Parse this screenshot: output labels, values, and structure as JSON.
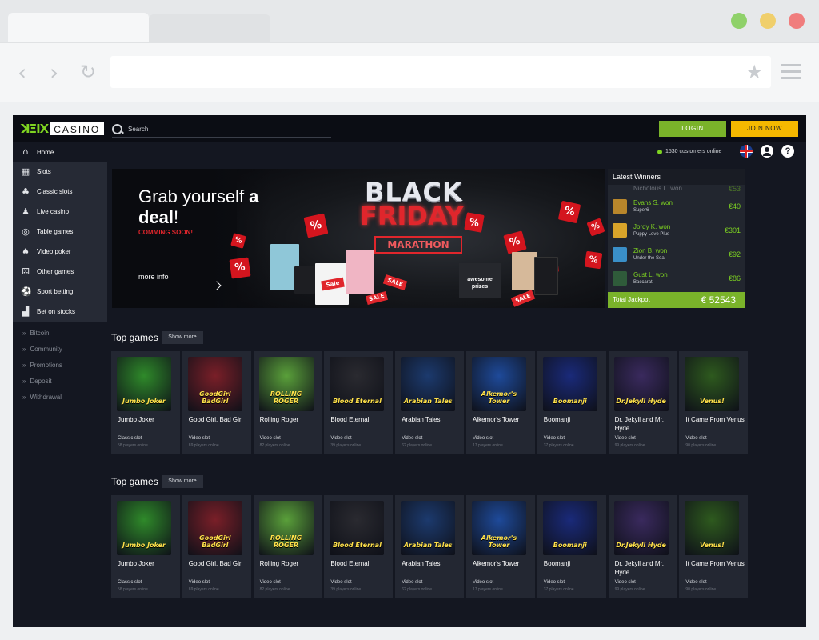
{
  "browser": {
    "url": ""
  },
  "header": {
    "logo_mark": "ꓘΞIX",
    "logo_text": "CASINO",
    "search_placeholder": "Search",
    "login_label": "LOGIN",
    "join_label": "JOIN NOW",
    "online_text": "1530 customers online",
    "help_glyph": "?"
  },
  "sidebar": {
    "home": "Home",
    "items": [
      {
        "label": "Slots",
        "icon": "slots-icon",
        "glyph": "▦"
      },
      {
        "label": "Classic slots",
        "icon": "cherries-icon",
        "glyph": "♣"
      },
      {
        "label": "Live casino",
        "icon": "dealer-icon",
        "glyph": "♟"
      },
      {
        "label": "Table games",
        "icon": "chips-icon",
        "glyph": "◎"
      },
      {
        "label": "Video poker",
        "icon": "cards-icon",
        "glyph": "♠"
      },
      {
        "label": "Other games",
        "icon": "dice-icon",
        "glyph": "⚄"
      },
      {
        "label": "Sport betting",
        "icon": "soccer-ball-icon",
        "glyph": "⚽"
      },
      {
        "label": "Bet on stocks",
        "icon": "chart-icon",
        "glyph": "▟"
      }
    ],
    "subnav": [
      "Bitcoin",
      "Community",
      "Promotions",
      "Deposit",
      "Withdrawal"
    ]
  },
  "banner": {
    "title_1": "Grab yourself ",
    "title_bold_1": "a",
    "title_bold_2": "deal",
    "title_end": "!",
    "subtitle": "COMMING SOON!",
    "more_info": "more info",
    "bf_black": "BLACK",
    "bf_friday": "FRIDAY",
    "bf_marathon": "MARATHON",
    "sale": "Sale",
    "box_label": "awesome prizes"
  },
  "winners": {
    "title": "Latest Winners",
    "rows": [
      {
        "name": "Evans S. won",
        "game": "Super6",
        "amount": "€40",
        "color": "#b8862b"
      },
      {
        "name": "Jordy K. won",
        "game": "Puppy Love Plus",
        "amount": "€301",
        "color": "#d9a42a"
      },
      {
        "name": "Zion B. won",
        "game": "Under the Sea",
        "amount": "€92",
        "color": "#3a8fc8"
      },
      {
        "name": "Gust L. won",
        "game": "Baccarat",
        "amount": "€86",
        "color": "#2f5b3a"
      }
    ],
    "partial": {
      "name": "Nicholous L. won",
      "amount": "€53"
    },
    "total_label": "Total Jackpot",
    "total_value": "€ 52543"
  },
  "sections": [
    {
      "title": "Top games",
      "show_more": "Show more"
    },
    {
      "title": "Top games",
      "show_more": "Show more"
    }
  ],
  "games": [
    {
      "name": "Jumbo Joker",
      "category": "Classic slot",
      "players": "58 players online",
      "art": "Jumbo Joker",
      "bg": "#2f8a2a"
    },
    {
      "name": "Good Girl, Bad Girl",
      "category": "Video slot",
      "players": "89 players online",
      "art": "GoodGirl BadGirl",
      "bg": "#7a1f28"
    },
    {
      "name": "Rolling Roger",
      "category": "Video slot",
      "players": "82 players online",
      "art": "ROLLING ROGER",
      "bg": "#5aa03a"
    },
    {
      "name": "Blood Eternal",
      "category": "Video slot",
      "players": "39 players online",
      "art": "Blood Eternal",
      "bg": "#2a2a30"
    },
    {
      "name": "Arabian Tales",
      "category": "Video slot",
      "players": "62 players online",
      "art": "Arabian Tales",
      "bg": "#1c3a6e"
    },
    {
      "name": "Alkemor's Tower",
      "category": "Video slot",
      "players": "17 players online",
      "art": "Alkemor's Tower",
      "bg": "#1e4a9a"
    },
    {
      "name": "Boomanji",
      "category": "Video slot",
      "players": "37 players online",
      "art": "Boomanji",
      "bg": "#1a2a7a"
    },
    {
      "name": "Dr. Jekyll and Mr. Hyde",
      "category": "Video slot",
      "players": "99 players online",
      "art": "Dr.Jekyll Hyde",
      "bg": "#3a2a5e"
    },
    {
      "name": "It Came From Venus",
      "category": "Video slot",
      "players": "90 players online",
      "art": "Venus!",
      "bg": "#2e5a1e"
    }
  ]
}
